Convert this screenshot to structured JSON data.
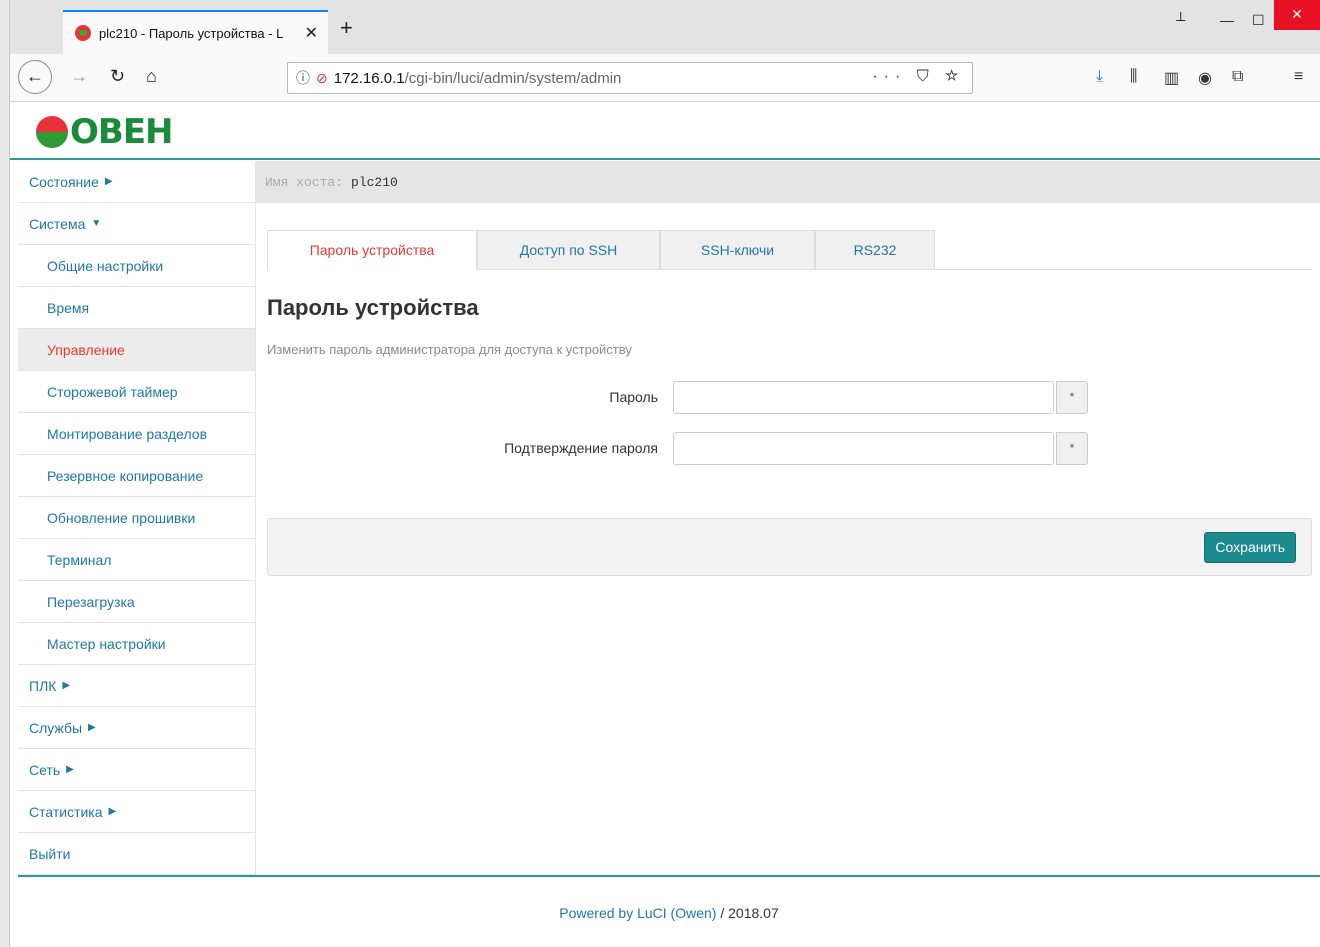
{
  "browser": {
    "tab_title": "plc210 - Пароль устройства - L",
    "tab_close": "✕",
    "new_tab": "+",
    "url_host": "172.16.0.1",
    "url_path": "/cgi-bin/luci/admin/system/admin",
    "url_actions": "··· ⛉ ☆"
  },
  "logo": {
    "text": "ОВЕН"
  },
  "sidebar": {
    "items": [
      {
        "label": "Состояние",
        "caret": "▶"
      },
      {
        "label": "Система",
        "caret": "▼"
      },
      {
        "label": "Общие настройки"
      },
      {
        "label": "Время"
      },
      {
        "label": "Управление"
      },
      {
        "label": "Сторожевой таймер"
      },
      {
        "label": "Монтирование разделов"
      },
      {
        "label": "Резервное копирование"
      },
      {
        "label": "Обновление прошивки"
      },
      {
        "label": "Терминал"
      },
      {
        "label": "Перезагрузка"
      },
      {
        "label": "Мастер настройки"
      },
      {
        "label": "ПЛК",
        "caret": "▶"
      },
      {
        "label": "Службы",
        "caret": "▶"
      },
      {
        "label": "Сеть",
        "caret": "▶"
      },
      {
        "label": "Статистика",
        "caret": "▶"
      },
      {
        "label": "Выйти"
      }
    ]
  },
  "hostbar": {
    "label": "Имя хоста:",
    "value": "plc210"
  },
  "tabs": [
    "Пароль устройства",
    "Доступ по SSH",
    "SSH-ключи",
    "RS232"
  ],
  "section": {
    "title": "Пароль устройства",
    "description": "Изменить пароль администратора для доступа к устройству"
  },
  "form": {
    "password_label": "Пароль",
    "confirm_label": "Подтверждение пароля",
    "reveal_symbol": "*"
  },
  "actions": {
    "save_label": "Сохранить"
  },
  "footer": {
    "link": "Powered by LuCI (Owen)",
    "version": " / 2018.07"
  },
  "colors": {
    "accent": "#2a9d8f",
    "active": "#e53935",
    "link": "#1e78a8",
    "button": "#1a8a8c"
  }
}
